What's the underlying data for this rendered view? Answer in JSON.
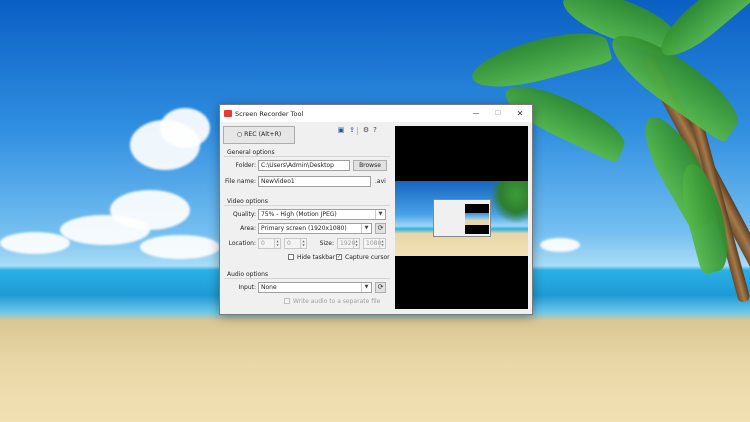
{
  "window": {
    "title": "Screen Recorder Tool",
    "controls": {
      "minimize": "—",
      "maximize": "☐",
      "close": "✕"
    }
  },
  "toolbar": {
    "rec_label": "REC (Alt+R)",
    "icons": [
      "monitor-icon",
      "upload-icon",
      "gear-icon",
      "help-icon"
    ]
  },
  "general": {
    "heading": "General options",
    "folder_label": "Folder:",
    "folder_value": "C:\\Users\\Admin\\Desktop",
    "browse_label": "Browse",
    "filename_label": "File name:",
    "filename_value": "NewVideo1",
    "extension": ".avi"
  },
  "video": {
    "heading": "Video options",
    "quality_label": "Quality:",
    "quality_value": "75% - High (Motion JPEG)",
    "area_label": "Area:",
    "area_value": "Primary screen (1920x1080)",
    "location_label": "Location:",
    "location_x": "0",
    "location_y": "0",
    "size_label": "Size:",
    "size_w": "1920",
    "size_h": "1080",
    "hide_taskbar_label": "Hide taskbar",
    "hide_taskbar_checked": false,
    "capture_cursor_label": "Capture cursor",
    "capture_cursor_checked": true
  },
  "audio": {
    "heading": "Audio options",
    "input_label": "Input:",
    "input_value": "None",
    "separate_label": "Write audio to a separate file",
    "separate_checked": false
  },
  "colors": {
    "app_icon": "#e53935",
    "window_bg": "#f0f0f0",
    "preview_bg": "#000000"
  }
}
